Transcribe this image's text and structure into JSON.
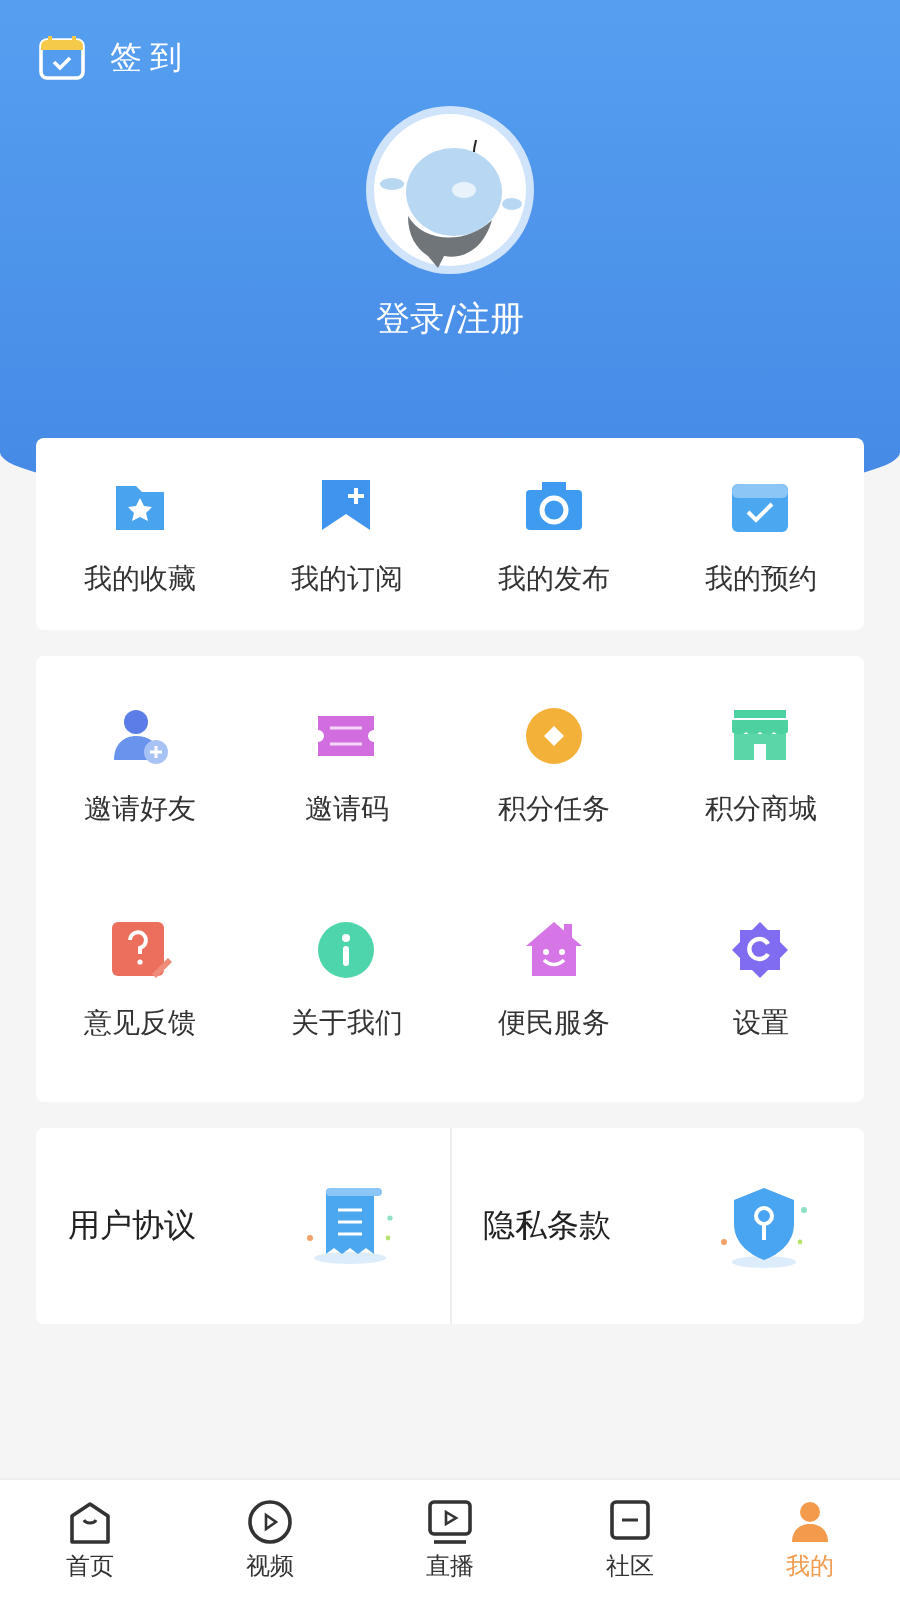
{
  "header": {
    "checkin": "签到",
    "login": "登录/注册"
  },
  "my_items": [
    {
      "label": "我的收藏"
    },
    {
      "label": "我的订阅"
    },
    {
      "label": "我的发布"
    },
    {
      "label": "我的预约"
    }
  ],
  "services": [
    {
      "label": "邀请好友"
    },
    {
      "label": "邀请码"
    },
    {
      "label": "积分任务"
    },
    {
      "label": "积分商城"
    },
    {
      "label": "意见反馈"
    },
    {
      "label": "关于我们"
    },
    {
      "label": "便民服务"
    },
    {
      "label": "设置"
    }
  ],
  "documents": [
    {
      "label": "用户协议"
    },
    {
      "label": "隐私条款"
    }
  ],
  "tab_bar": [
    {
      "label": "首页",
      "selected": false
    },
    {
      "label": "视频",
      "selected": false
    },
    {
      "label": "直播",
      "selected": false
    },
    {
      "label": "社区",
      "selected": false
    },
    {
      "label": "我的",
      "selected": true
    }
  ]
}
